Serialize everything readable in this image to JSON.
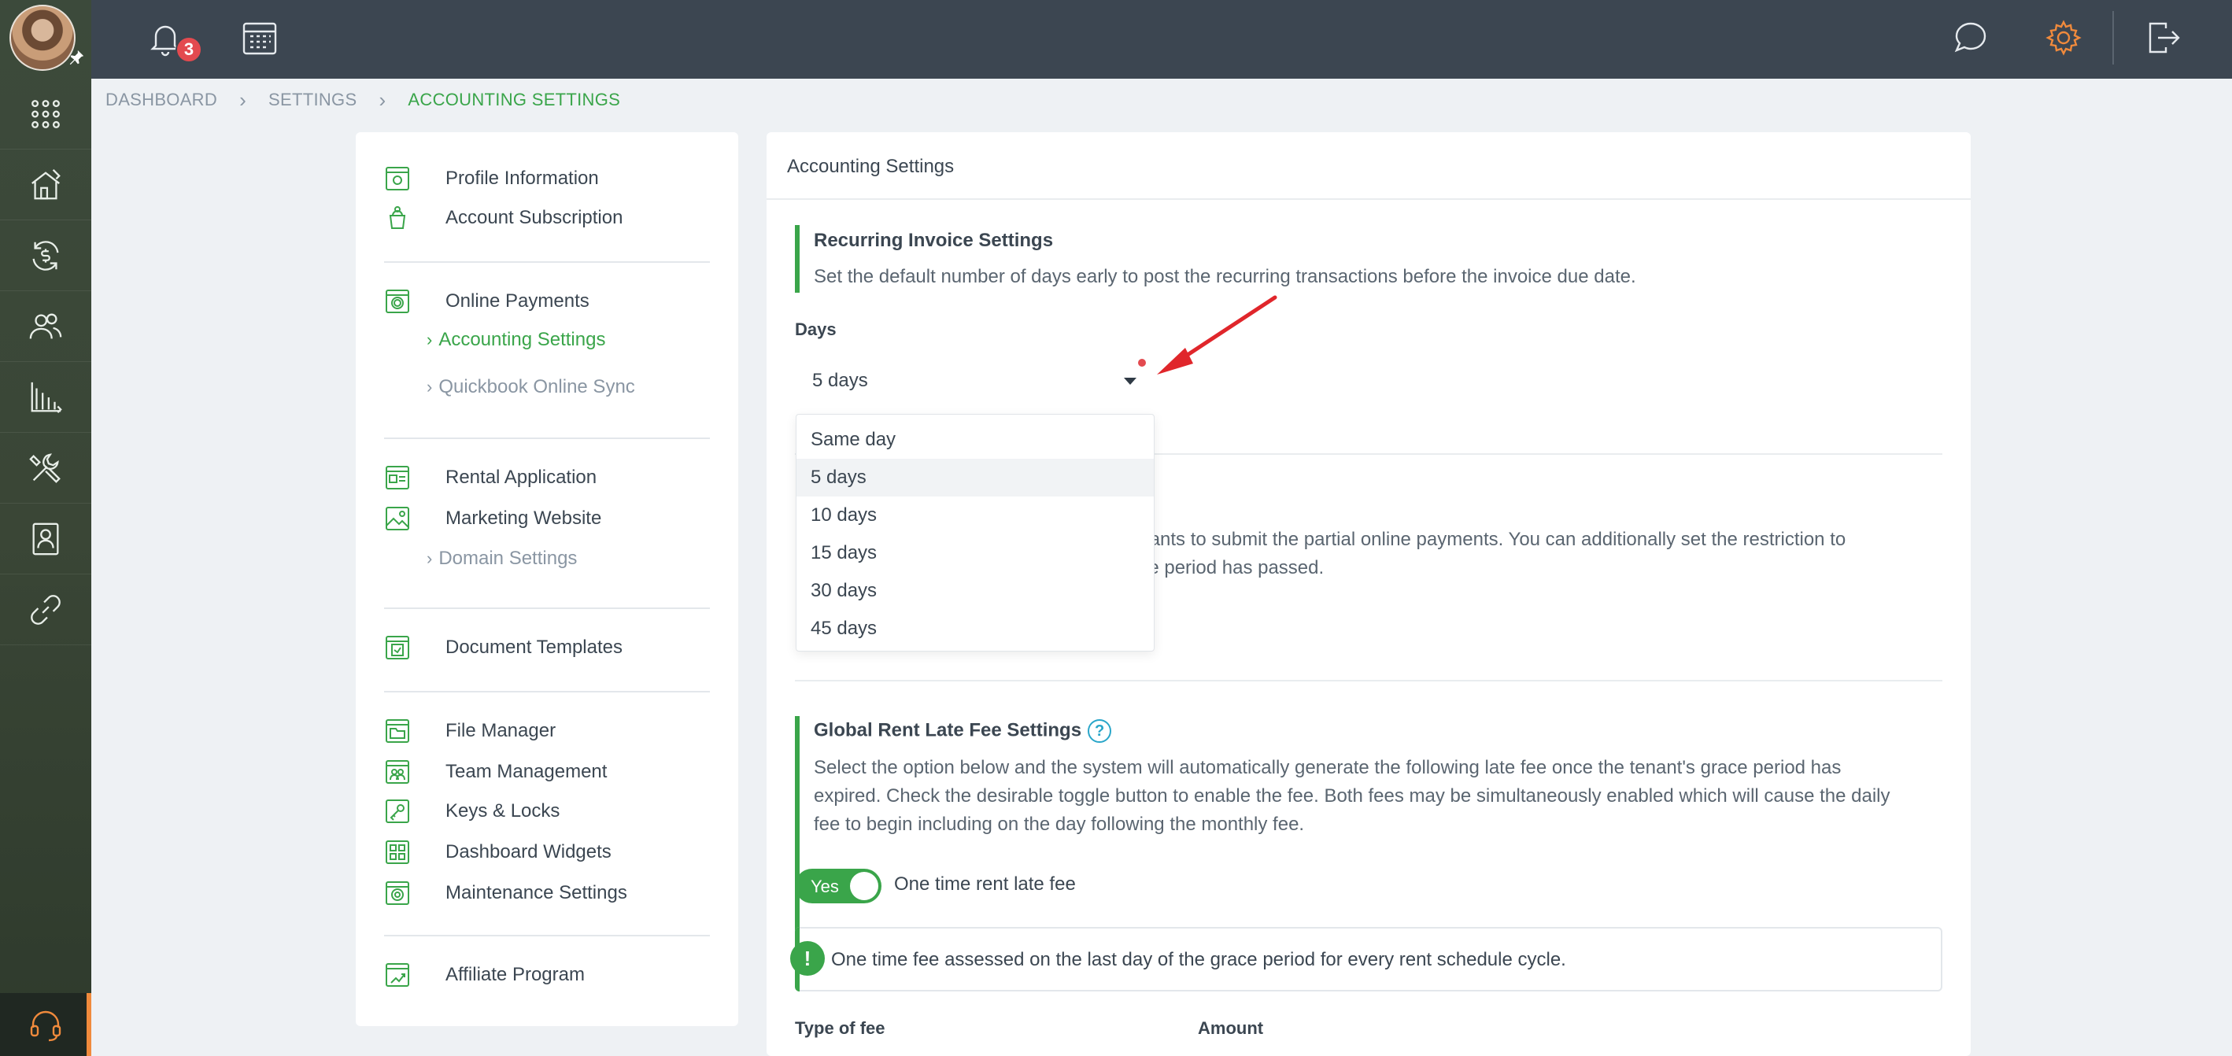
{
  "topbar": {
    "notification_count": "3",
    "icons": [
      "bell-icon",
      "calendar-icon",
      "chat-icon",
      "gear-icon",
      "logout-icon"
    ],
    "accent_color": "#f08a3c"
  },
  "sidebar": {
    "items": [
      "apps-grid-icon",
      "property-icon",
      "payments-icon",
      "contacts-icon",
      "reports-icon",
      "maintenance-icon",
      "tenant-icon",
      "integrations-icon"
    ],
    "support_icon": "headset-icon"
  },
  "breadcrumb": {
    "items": [
      "DASHBOARD",
      "SETTINGS",
      "ACCOUNTING SETTINGS"
    ]
  },
  "settings_nav": {
    "profile_information": "Profile Information",
    "account_subscription": "Account Subscription",
    "online_payments": "Online Payments",
    "accounting_settings": "Accounting Settings",
    "quickbook_online_sync": "Quickbook Online Sync",
    "rental_application": "Rental Application",
    "marketing_website": "Marketing Website",
    "domain_settings": "Domain Settings",
    "document_templates": "Document Templates",
    "file_manager": "File Manager",
    "team_management": "Team Management",
    "keys_locks": "Keys & Locks",
    "dashboard_widgets": "Dashboard Widgets",
    "maintenance_settings": "Maintenance Settings",
    "affiliate_program": "Affiliate Program"
  },
  "main": {
    "title": "Accounting Settings",
    "recurring": {
      "title": "Recurring Invoice Settings",
      "description": "Set the default number of days early to post the recurring transactions before the invoice due date.",
      "days_label": "Days",
      "selected": "5 days",
      "options": [
        "Same day",
        "5 days",
        "10 days",
        "15 days",
        "30 days",
        "45 days"
      ]
    },
    "partial": {
      "line1": "enants to submit the partial online payments. You can additionally set the restriction to",
      "line2": "ace period has passed."
    },
    "late_fee": {
      "title": "Global Rent Late Fee Settings",
      "description_line1": "Select the option below and the system will automatically generate the following late fee once the tenant's grace period has",
      "description_line2": "expired. Check the desirable toggle button to enable the fee. Both fees may be simultaneously enabled which will cause the daily",
      "description_line3": "fee to begin including on the day following the monthly fee.",
      "toggle_label": "Yes",
      "toggle_text": "One time rent late fee",
      "note": "One time fee assessed on the last day of the grace period for every rent schedule cycle.",
      "col_type": "Type of fee",
      "col_amount": "Amount"
    }
  },
  "colors": {
    "green": "#3aa54a",
    "topbar": "#3c4651",
    "red": "#e34a4f"
  }
}
